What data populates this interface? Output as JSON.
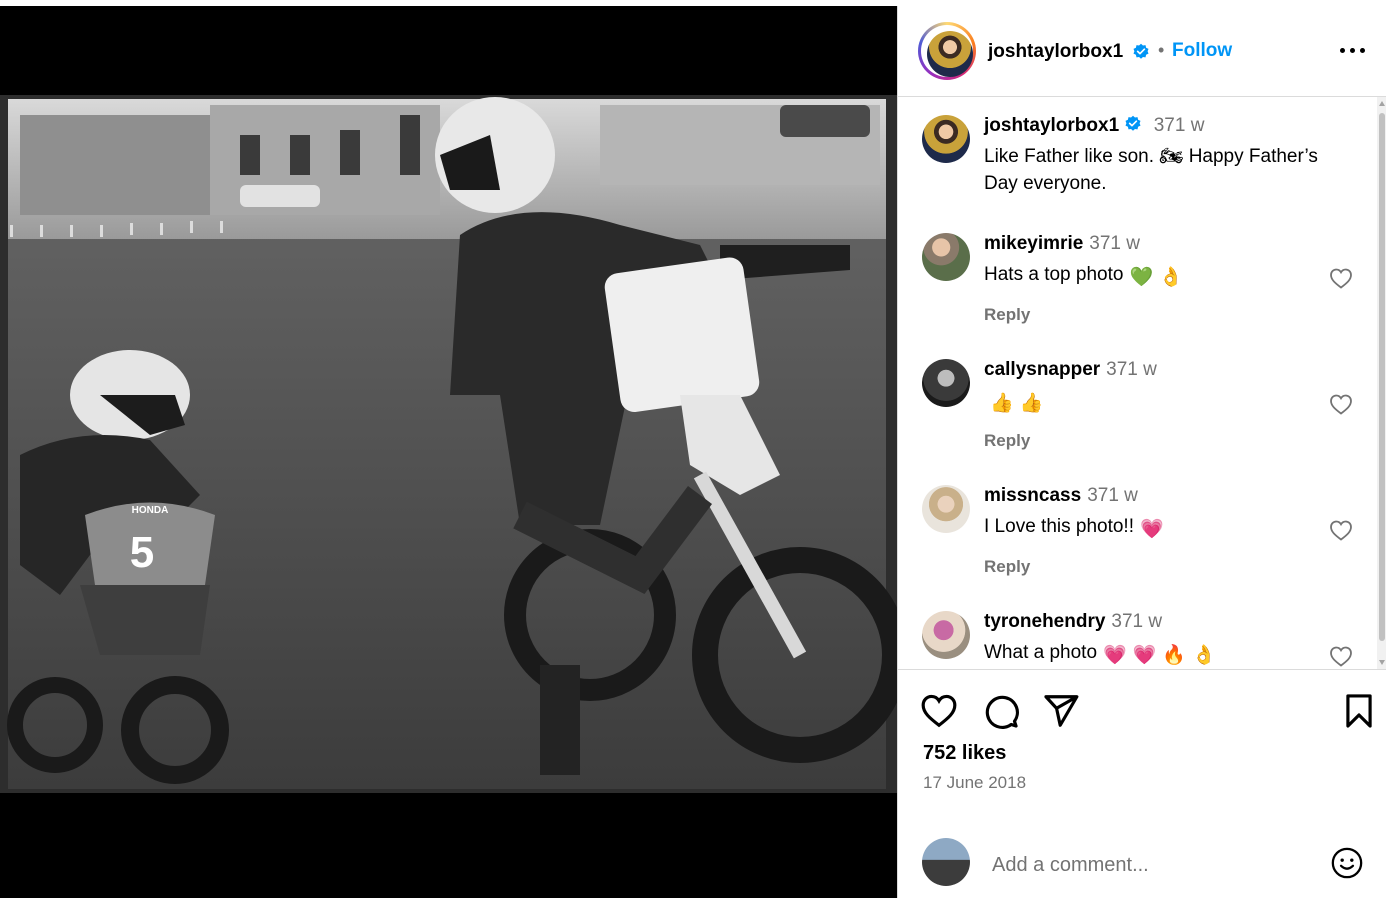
{
  "post": {
    "image_alt": "Black and white photo: adult on a dirt bike and a child on a small Honda bike number 5",
    "bike_number": "5",
    "bike_brand": "HONDA"
  },
  "header": {
    "username": "joshtaylorbox1",
    "separator": "•",
    "follow_label": "Follow",
    "more_icon": "more-horizontal-icon"
  },
  "caption": {
    "username": "joshtaylorbox1",
    "time": "371 w",
    "text": "Like Father like son. 🏍 Happy Father’s Day everyone."
  },
  "comments": [
    {
      "username": "mikeyimrie",
      "time": "371 w",
      "text": "Hats a top photo",
      "emojis": [
        "💚",
        "👌"
      ],
      "reply": "Reply"
    },
    {
      "username": "callysnapper",
      "time": "371 w",
      "text": "",
      "emojis": [
        "👍",
        "👍"
      ],
      "reply": "Reply"
    },
    {
      "username": "missncass",
      "time": "371 w",
      "text": "I Love this photo!!",
      "emojis": [
        "💗"
      ],
      "reply": "Reply"
    },
    {
      "username": "tyronehendry",
      "time": "371 w",
      "text": "What a photo",
      "emojis": [
        "💗",
        "💗",
        "🔥",
        "👌"
      ]
    }
  ],
  "actions": {
    "likes": "752 likes",
    "date": "17 June 2018"
  },
  "add_comment": {
    "placeholder": "Add a comment..."
  },
  "colors": {
    "follow_blue": "#0095f6",
    "verified_blue": "#0095f6",
    "secondary_text": "#737373"
  }
}
